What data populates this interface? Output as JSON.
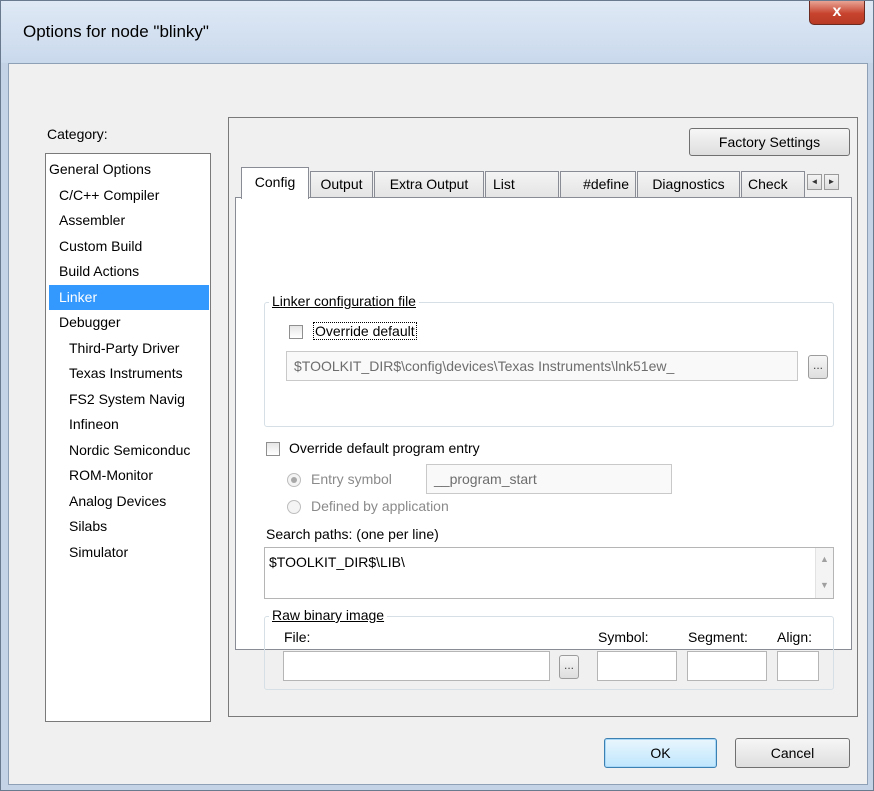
{
  "window": {
    "title": "Options for node \"blinky\"",
    "close_glyph": "x"
  },
  "category": {
    "label": "Category:",
    "items": [
      {
        "label": "General Options"
      },
      {
        "label": "C/C++ Compiler"
      },
      {
        "label": "Assembler"
      },
      {
        "label": "Custom Build"
      },
      {
        "label": "Build Actions"
      },
      {
        "label": "Linker",
        "selected": true
      },
      {
        "label": "Debugger"
      },
      {
        "label": "Third-Party Driver"
      },
      {
        "label": "Texas Instruments"
      },
      {
        "label": "FS2 System Navig"
      },
      {
        "label": "Infineon"
      },
      {
        "label": "Nordic Semiconduc"
      },
      {
        "label": "ROM-Monitor"
      },
      {
        "label": "Analog Devices"
      },
      {
        "label": "Silabs"
      },
      {
        "label": "Simulator"
      }
    ]
  },
  "factory_settings": "Factory Settings",
  "tabs": [
    {
      "label": "Config",
      "active": true
    },
    {
      "label": "Output"
    },
    {
      "label": "Extra Output"
    },
    {
      "label": "List"
    },
    {
      "label": "#define"
    },
    {
      "label": "Diagnostics"
    },
    {
      "label": "Check"
    }
  ],
  "tab_scroll": {
    "left": "◄",
    "right": "►"
  },
  "linker_config": {
    "group_title": "Linker configuration file",
    "override_default": "Override default",
    "path": "$TOOLKIT_DIR$\\config\\devices\\Texas Instruments\\lnk51ew_",
    "browse": "..."
  },
  "program_entry": {
    "override_label": "Override default program entry",
    "entry_symbol_label": "Entry symbol",
    "entry_symbol_value": "__program_start",
    "defined_by_app_label": "Defined by application"
  },
  "search_paths": {
    "label": "Search paths:  (one per line)",
    "value": "$TOOLKIT_DIR$\\LIB\\",
    "scroll_up": "▲",
    "scroll_down": "▼"
  },
  "raw_binary": {
    "group_title": "Raw binary image",
    "file_label": "File:",
    "symbol_label": "Symbol:",
    "segment_label": "Segment:",
    "align_label": "Align:",
    "browse": "..."
  },
  "footer": {
    "ok": "OK",
    "cancel": "Cancel"
  }
}
